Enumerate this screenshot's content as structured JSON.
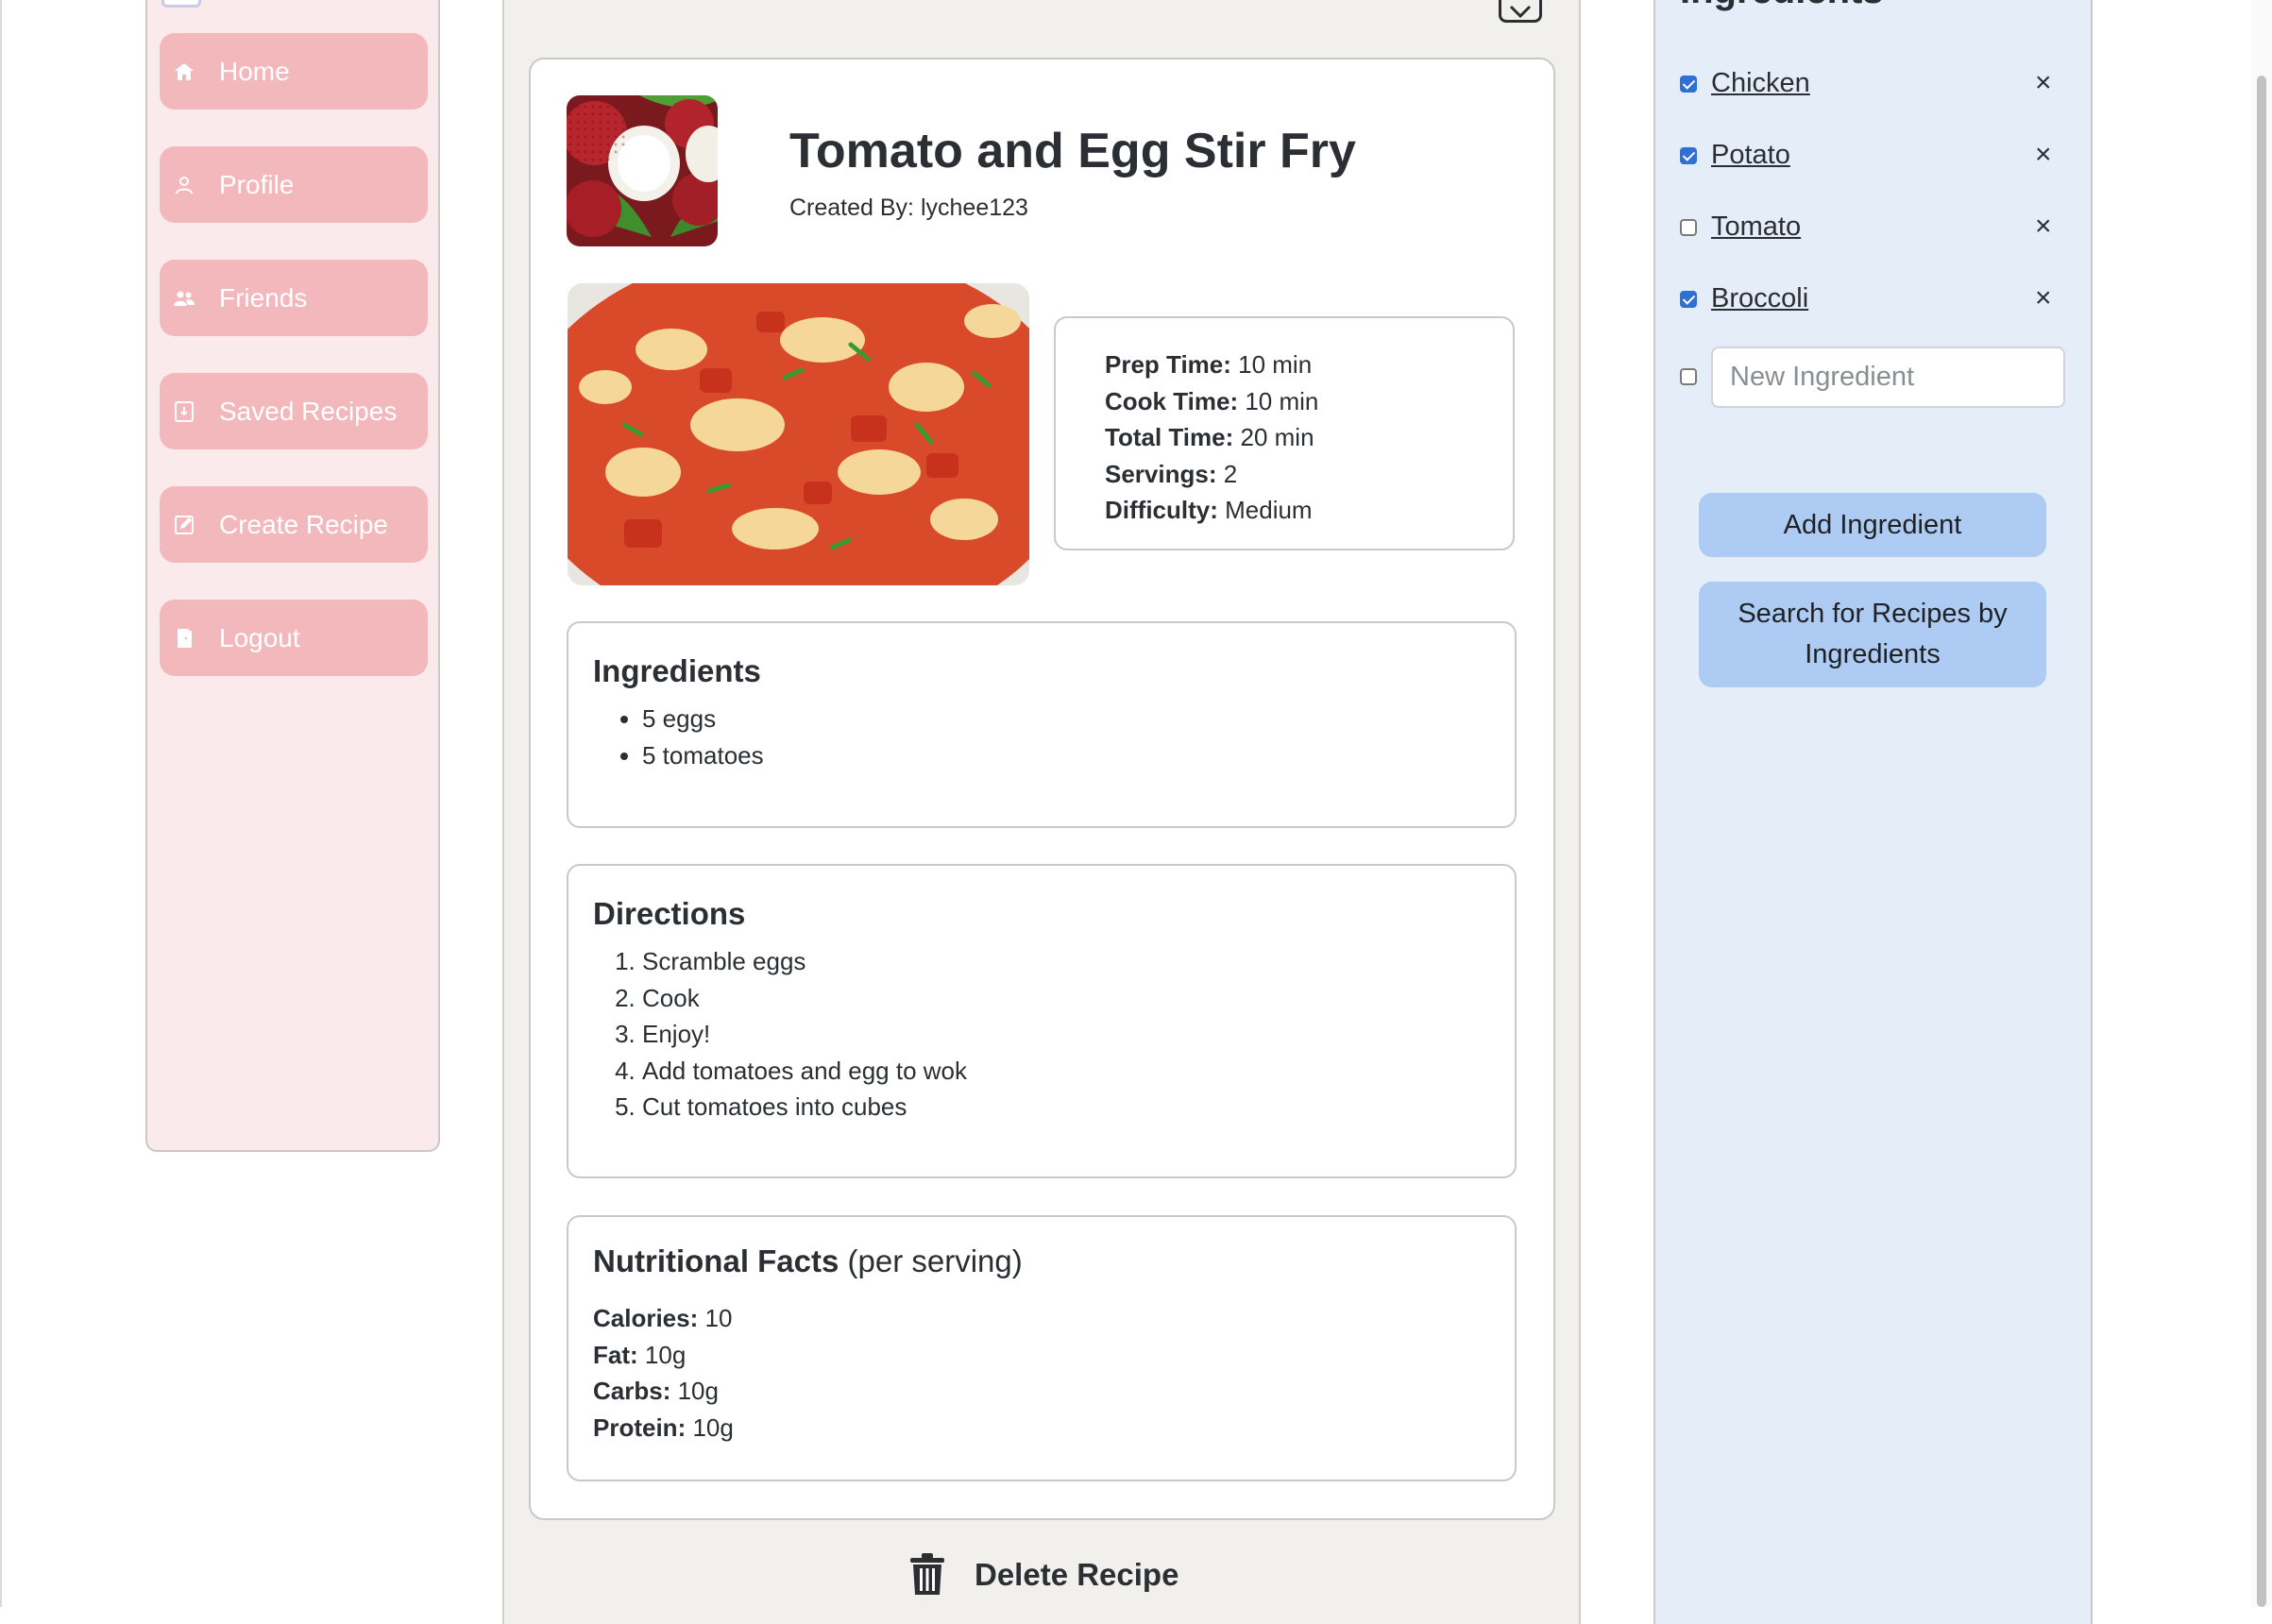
{
  "sidebar": {
    "items": [
      {
        "label": "Home",
        "icon": "home-icon"
      },
      {
        "label": "Profile",
        "icon": "user-icon"
      },
      {
        "label": "Friends",
        "icon": "friends-icon"
      },
      {
        "label": "Saved Recipes",
        "icon": "bookmark-icon"
      },
      {
        "label": "Create Recipe",
        "icon": "edit-icon"
      },
      {
        "label": "Logout",
        "icon": "door-icon"
      }
    ]
  },
  "recipe": {
    "title": "Tomato and Egg Stir Fry",
    "created_by": "Created By: lychee123",
    "times": [
      {
        "label": "Prep Time:",
        "value": " 10 min"
      },
      {
        "label": "Cook Time:",
        "value": " 10 min"
      },
      {
        "label": "Total Time:",
        "value": " 20 min"
      },
      {
        "label": "Servings:",
        "value": " 2"
      },
      {
        "label": "Difficulty:",
        "value": " Medium"
      }
    ],
    "ingredients_title": "Ingredients",
    "ingredients": [
      "5 eggs",
      "5 tomatoes"
    ],
    "directions_title": "Directions",
    "directions": [
      "Scramble eggs",
      "Cook",
      "Enjoy!",
      "Add tomatoes and egg to wok",
      "Cut tomatoes into cubes"
    ],
    "nutrition_title": "Nutritional Facts",
    "nutrition_sub": " (per serving)",
    "nutrition": [
      {
        "label": "Calories:",
        "value": " 10"
      },
      {
        "label": "Fat:",
        "value": " 10g"
      },
      {
        "label": "Carbs:",
        "value": " 10g"
      },
      {
        "label": "Protein:",
        "value": " 10g"
      }
    ],
    "delete_label": "Delete Recipe"
  },
  "panel": {
    "title": "Ingredients",
    "items": [
      {
        "name": "Chicken",
        "checked": true
      },
      {
        "name": "Potato",
        "checked": true
      },
      {
        "name": "Tomato",
        "checked": false
      },
      {
        "name": "Broccoli",
        "checked": true
      }
    ],
    "remove_glyph": "×",
    "new_placeholder": "New Ingredient",
    "add_label": "Add Ingredient",
    "search_label": "Search for Recipes by Ingredients"
  },
  "colors": {
    "nav_button": "#f2b8bb",
    "sidebar_bg": "#fbeaeb",
    "panel_bg": "#e5edf8",
    "panel_button": "#aecbf4",
    "checkbox": "#2f6fd6"
  }
}
